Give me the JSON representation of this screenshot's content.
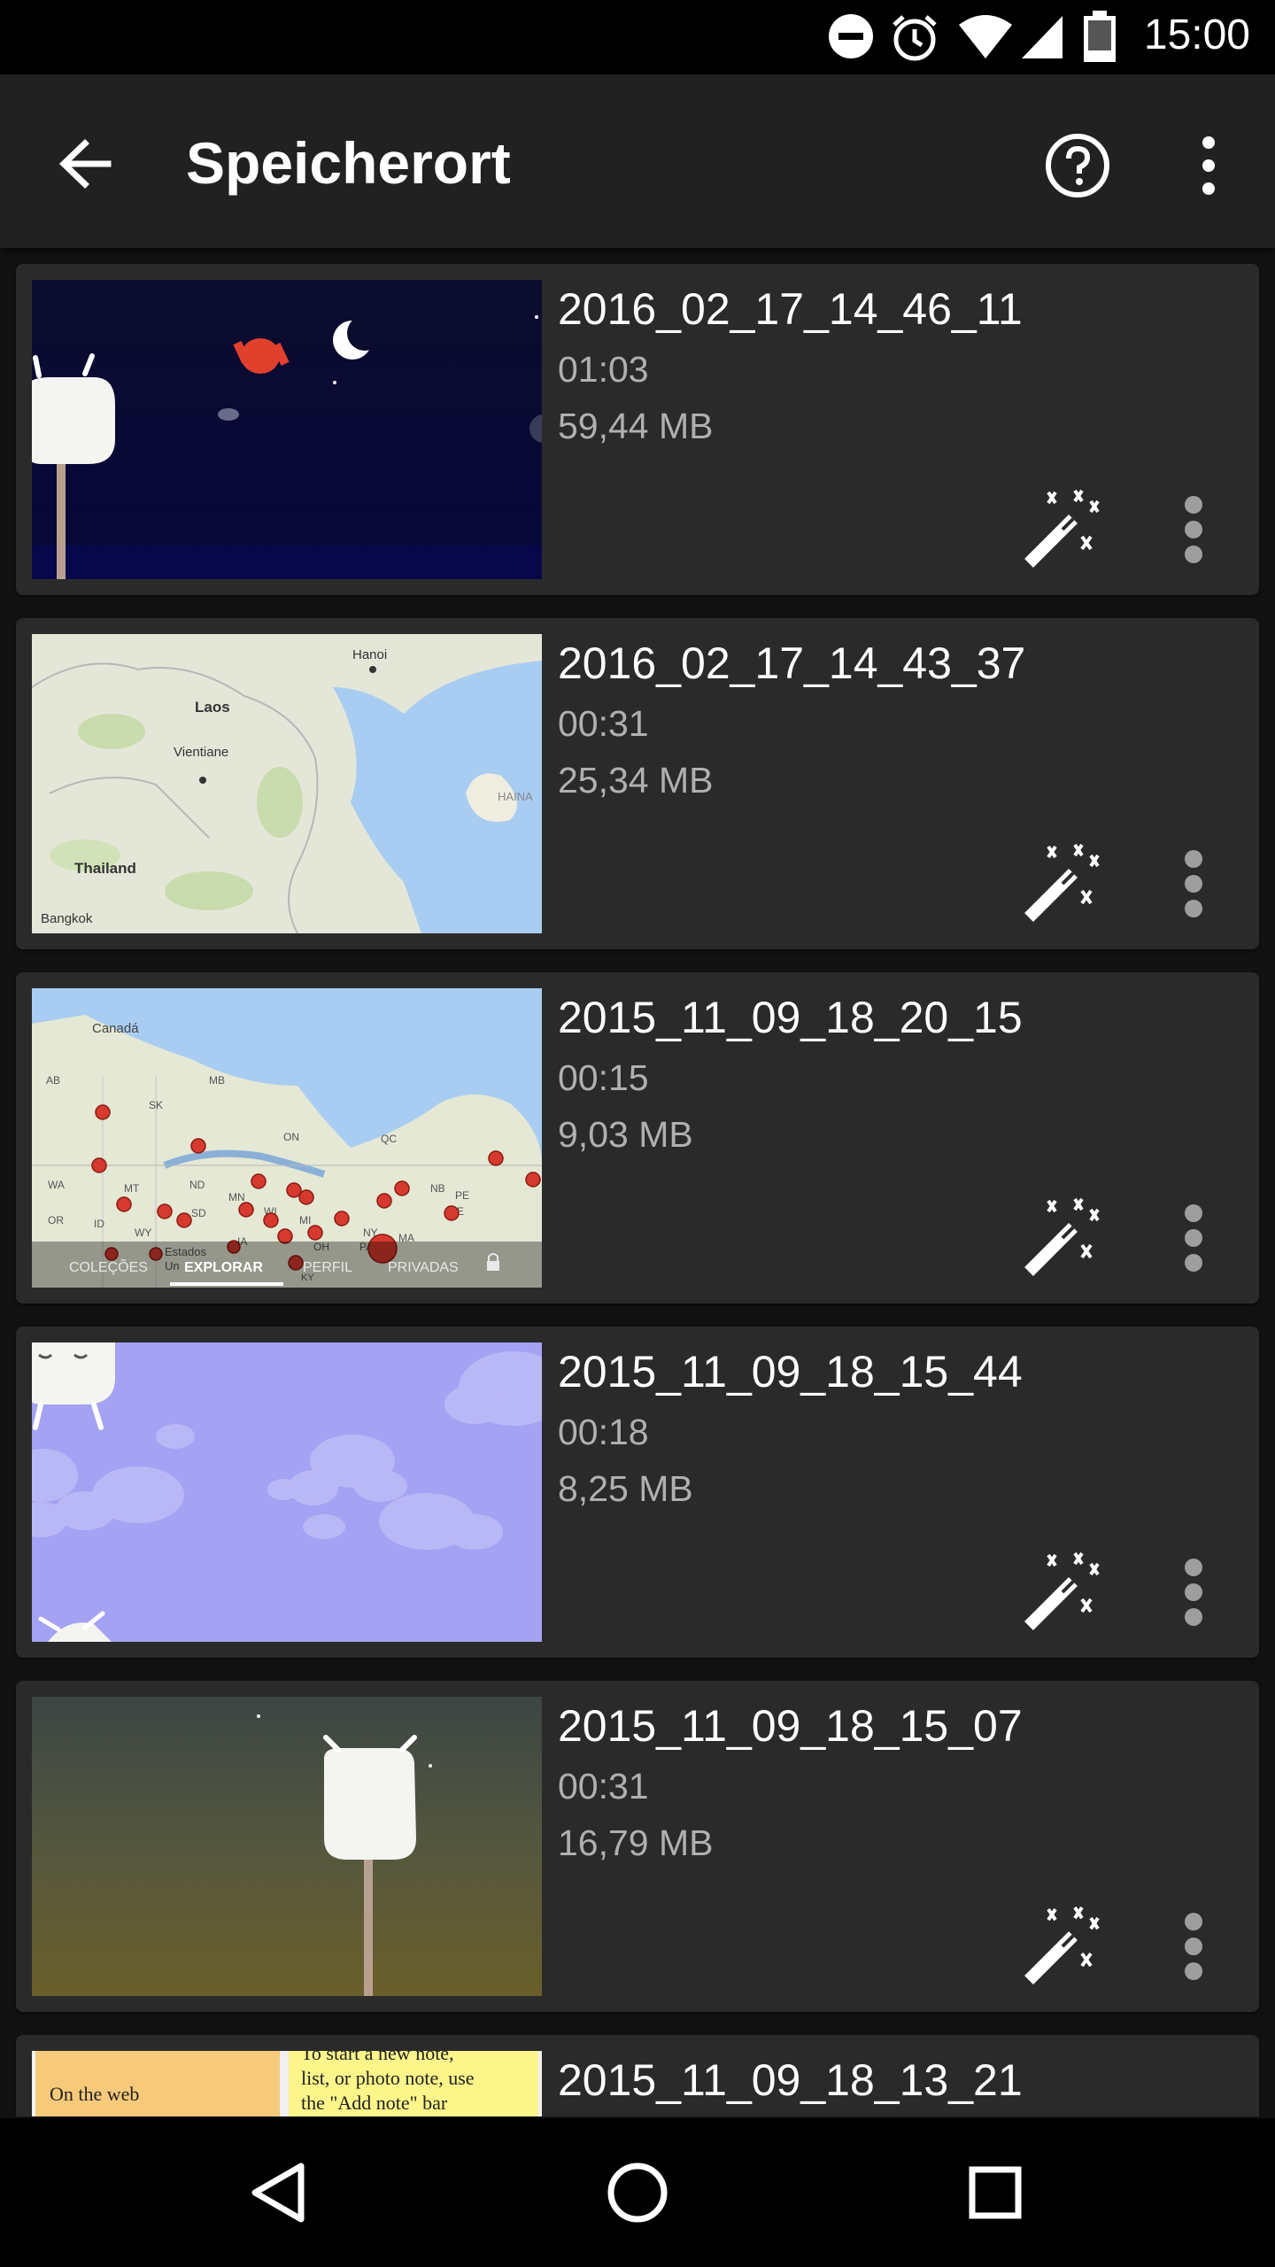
{
  "status_bar": {
    "time": "15:00",
    "icons": [
      "do-not-disturb-icon",
      "alarm-icon",
      "wifi-icon",
      "signal-icon",
      "battery-icon"
    ]
  },
  "toolbar": {
    "title": "Speicherort",
    "back_icon": "arrow-back-icon",
    "help_icon": "help-circle-icon",
    "more_icon": "more-vert-icon"
  },
  "recordings": [
    {
      "name": "2016_02_17_14_46_11",
      "duration": "01:03",
      "size": "59,44 MB"
    },
    {
      "name": "2016_02_17_14_43_37",
      "duration": "00:31",
      "size": "25,34 MB"
    },
    {
      "name": "2015_11_09_18_20_15",
      "duration": "00:15",
      "size": "9,03 MB"
    },
    {
      "name": "2015_11_09_18_15_44",
      "duration": "00:18",
      "size": "8,25 MB"
    },
    {
      "name": "2015_11_09_18_15_07",
      "duration": "00:31",
      "size": "16,79 MB"
    },
    {
      "name": "2015_11_09_18_13_21",
      "duration": "",
      "size": ""
    }
  ],
  "thumbnails": {
    "map1": {
      "labels": [
        "Hanoi",
        "Laos",
        "Vientiane",
        "Thailand",
        "Bangkok",
        "HAINA"
      ]
    },
    "map2": {
      "labels": [
        "Canadá",
        "AB",
        "SK",
        "MB",
        "ON",
        "QC",
        "WA",
        "MT",
        "ND",
        "MN",
        "WI",
        "MI",
        "NB",
        "PE",
        "ME",
        "ID",
        "WY",
        "SD",
        "IA",
        "OH",
        "PA",
        "NY",
        "MA",
        "OR",
        "Estados",
        "Un",
        "KY"
      ],
      "tabs": [
        "COLEÇÕES",
        "EXPLORAR",
        "PERFIL",
        "PRIVADAS"
      ],
      "active_tab": "EXPLORAR"
    },
    "notes": {
      "left_text": "On the web",
      "right_lines": [
        "To start a new note,",
        "list, or photo note, use",
        "the \"Add note\" bar"
      ]
    }
  },
  "item_actions": {
    "magic_icon": "magic-wand-icon",
    "overflow_icon": "more-vert-icon"
  },
  "nav_bar": {
    "back_icon": "nav-back-icon",
    "home_icon": "nav-home-icon",
    "recents_icon": "nav-recents-icon"
  }
}
